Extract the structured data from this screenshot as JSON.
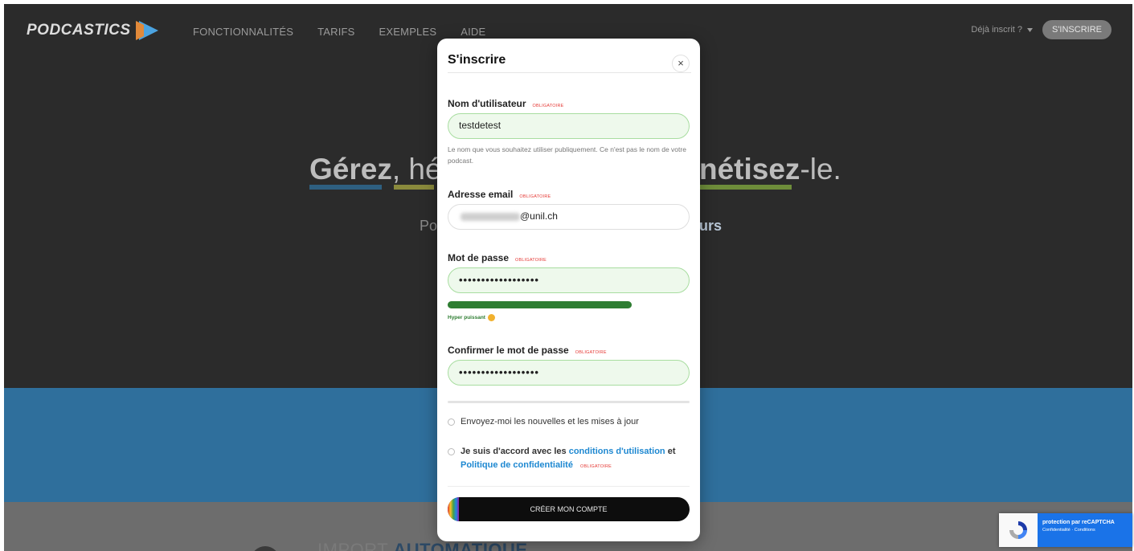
{
  "nav": {
    "logo": "PODCASTICS",
    "links": [
      "FONCTIONNALITÉS",
      "TARIFS",
      "EXEMPLES",
      "AIDE"
    ],
    "already_registered": "Déjà inscrit ?",
    "signup": "S'INSCRIRE"
  },
  "hero": {
    "headline_left_bold": "Gérez",
    "headline_left_rest": ", héb",
    "headline_right_bold": "nétisez",
    "headline_right_rest": "-le.",
    "sub_left": "Po",
    "sub_right": "urs"
  },
  "bottom": {
    "text_light": "IMPORT ",
    "text_bold": "AUTOMATIQUE"
  },
  "modal": {
    "title": "S'inscrire",
    "close_symbol": "×",
    "required_tag": "OBLIGATOIRE",
    "username": {
      "label": "Nom d'utilisateur",
      "value": "testdetest",
      "help": "Le nom que vous souhaitez utiliser publiquement. Ce n'est pas le nom de votre podcast."
    },
    "email": {
      "label": "Adresse email",
      "value_visible": "@unil.ch"
    },
    "password": {
      "label": "Mot de passe",
      "value": "••••••••••••••••••",
      "strength_label": "Hyper puissant",
      "strength_level": 0.76
    },
    "confirm": {
      "label": "Confirmer le mot de passe",
      "value": "••••••••••••••••••"
    },
    "newsletter": "Envoyez-moi les nouvelles et les mises à jour",
    "terms": {
      "prefix": "Je suis d'accord avec les ",
      "terms_link": "conditions d'utilisation",
      "and": " et",
      "privacy_link": "Politique de confidentialité"
    },
    "submit": "CRÉER MON COMPTE"
  },
  "recaptcha": {
    "title": "protection par reCAPTCHA",
    "links": "Confidentialité · Conditions"
  },
  "colors": {
    "valid_border": "#a8dda0",
    "valid_bg": "#eef9ec",
    "strength": "#2e7d32",
    "required": "#e53935",
    "link": "#1e88d1"
  }
}
